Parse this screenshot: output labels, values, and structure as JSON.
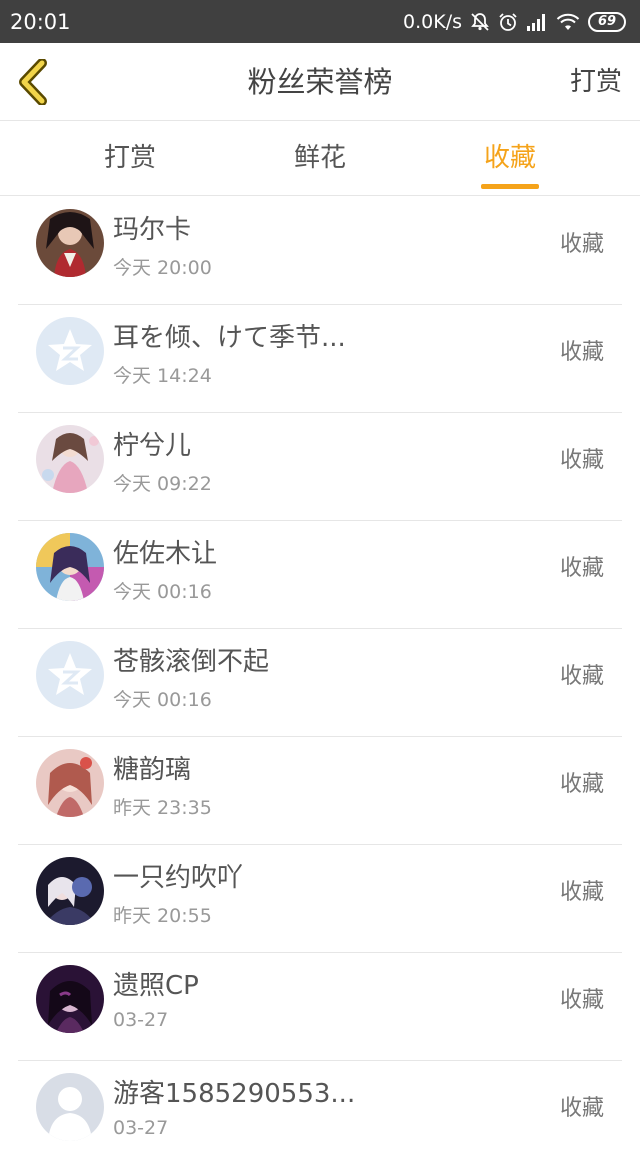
{
  "status_bar": {
    "time": "20:01",
    "network_speed": "0.0K/s",
    "battery": "69",
    "icons": [
      "mute-bell-icon",
      "alarm-icon",
      "signal-icon",
      "wifi-icon",
      "battery-icon"
    ]
  },
  "header": {
    "title": "粉丝荣誉榜",
    "action": "打赏",
    "back_icon": "chevron-left-icon",
    "accent_color": "#f5a31a"
  },
  "tabs": [
    {
      "label": "打赏",
      "active": false
    },
    {
      "label": "鲜花",
      "active": false
    },
    {
      "label": "收藏",
      "active": true
    }
  ],
  "list": [
    {
      "name": "玛尔卡",
      "time": "今天 20:00",
      "action": "收藏",
      "avatar": "anime-avatar-dark"
    },
    {
      "name": "耳を倾、けて季节...",
      "time": "今天 14:24",
      "action": "收藏",
      "avatar": "default-qzone-avatar"
    },
    {
      "name": "柠兮儿",
      "time": "今天 09:22",
      "action": "收藏",
      "avatar": "anime-avatar-pink"
    },
    {
      "name": "佐佐木让",
      "time": "今天 00:16",
      "action": "收藏",
      "avatar": "anime-avatar-colorful"
    },
    {
      "name": "苍骸滚倒不起",
      "time": "今天 00:16",
      "action": "收藏",
      "avatar": "default-qzone-avatar"
    },
    {
      "name": "糖韵璃",
      "time": "昨天 23:35",
      "action": "收藏",
      "avatar": "anime-avatar-rose"
    },
    {
      "name": "一只约吹吖",
      "time": "昨天 20:55",
      "action": "收藏",
      "avatar": "anime-avatar-night"
    },
    {
      "name": "遗照CP",
      "time": "03-27",
      "action": "收藏",
      "avatar": "anime-avatar-purple"
    },
    {
      "name": "游客1585290553...",
      "time": "03-27",
      "action": "收藏",
      "avatar": "default-person-avatar"
    }
  ]
}
